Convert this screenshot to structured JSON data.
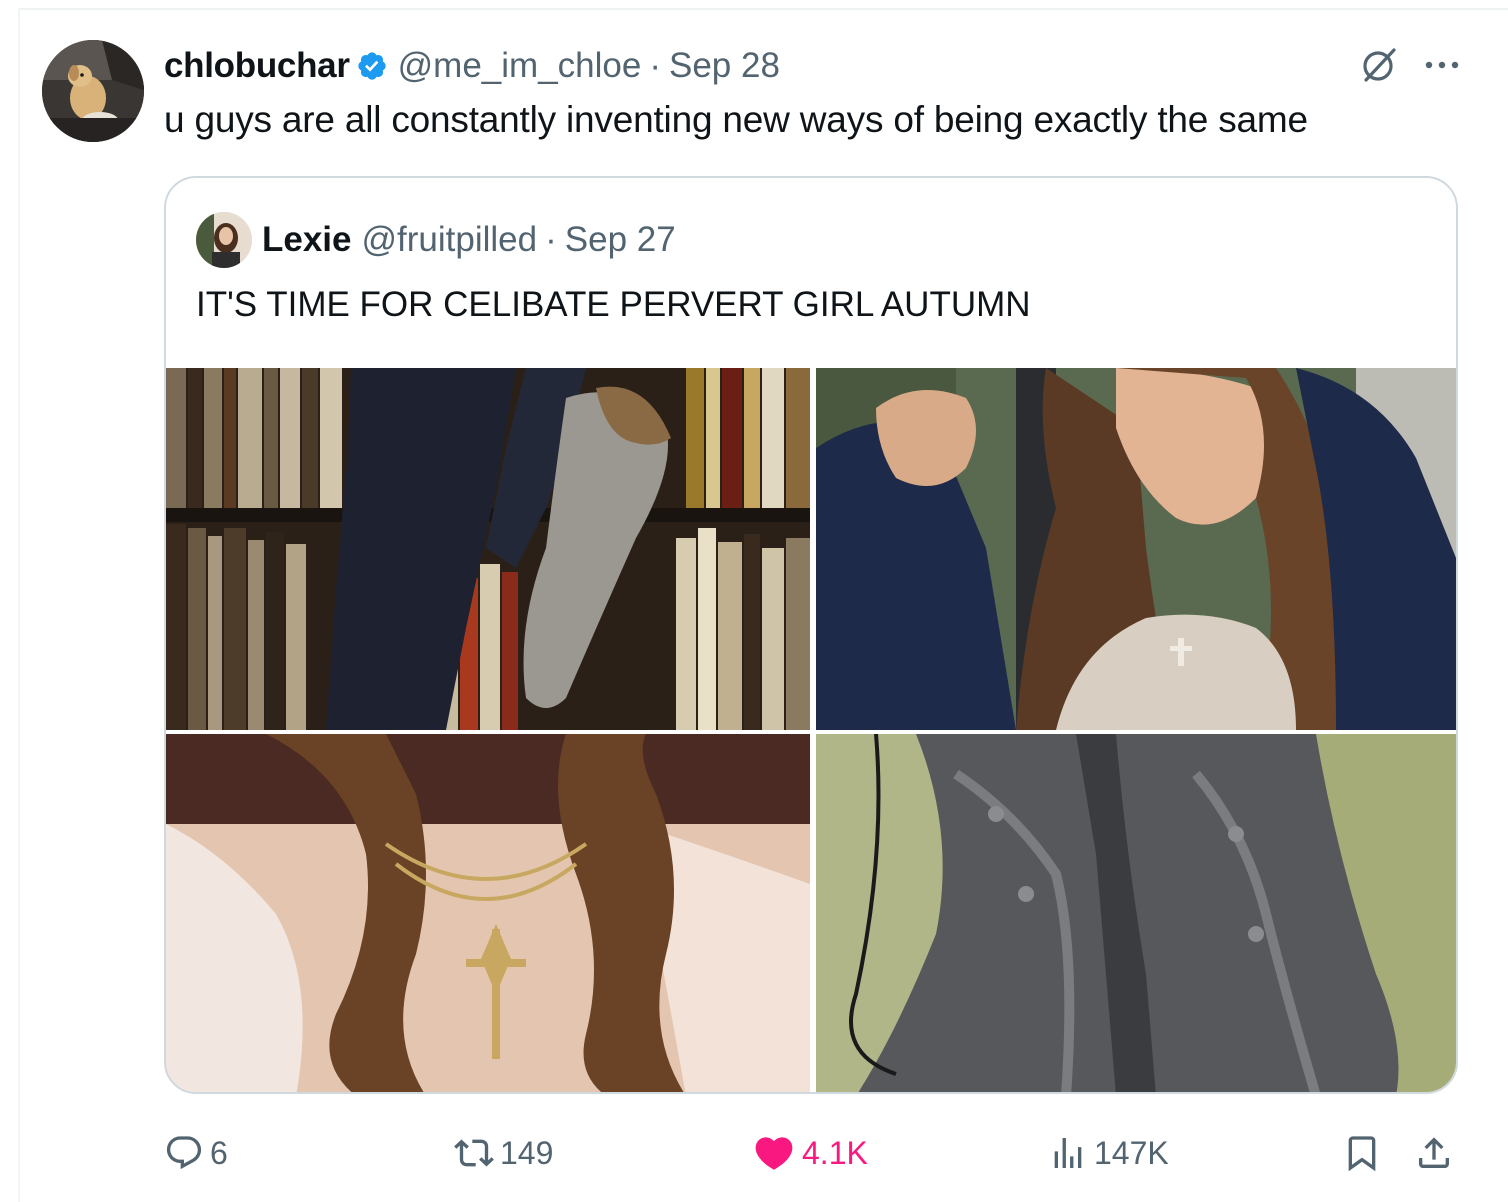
{
  "tweet": {
    "display_name": "chlobuchar",
    "handle": "@me_im_chloe",
    "separator": "·",
    "date": "Sep 28",
    "text": "u guys are all constantly inventing new ways of being exactly the same",
    "avatar_icon": "avatar-dog-photo",
    "verified_icon": "verified-badge-icon"
  },
  "quote": {
    "display_name": "Lexie",
    "handle": "@fruitpilled",
    "separator": "·",
    "date": "Sep 27",
    "text": "IT'S TIME FOR CELIBATE PERVERT GIRL AUTUMN",
    "media": [
      {
        "name": "photo-stockings-bookshelf"
      },
      {
        "name": "photo-woman-hair"
      },
      {
        "name": "photo-necklace-lace"
      },
      {
        "name": "photo-iron-corset"
      }
    ]
  },
  "actions": {
    "reply_count": "6",
    "retweet_count": "149",
    "like_count": "4.1K",
    "views_count": "147K"
  },
  "colors": {
    "text": "#0f1419",
    "muted": "#536471",
    "border": "#cfd9de",
    "like": "#f91880",
    "verified": "#1d9bf0"
  }
}
